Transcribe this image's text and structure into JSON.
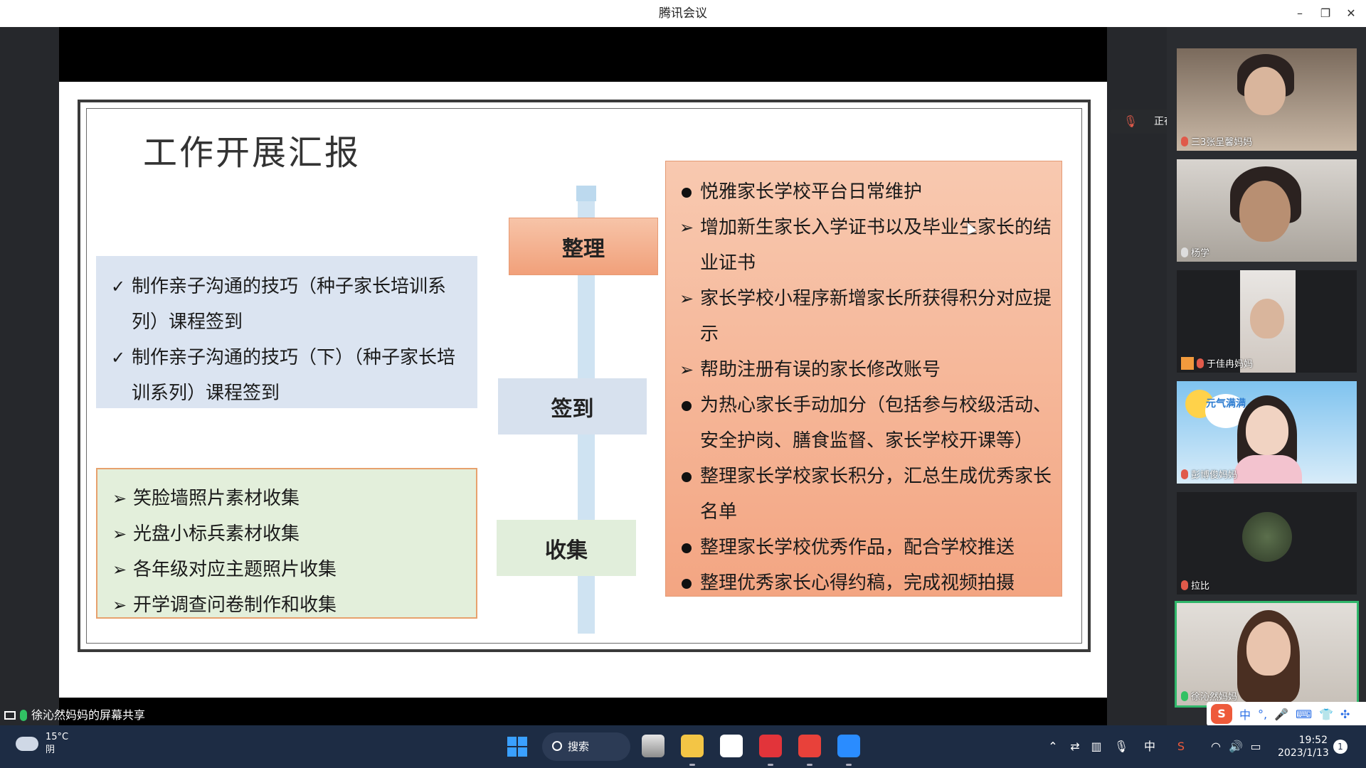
{
  "window": {
    "title": "腾讯会议",
    "minimize": "–",
    "restore": "❐",
    "close": "✕"
  },
  "slide": {
    "title": "工作开展汇报",
    "labels": {
      "zhengli": "整理",
      "qiandao": "签到",
      "shouji": "收集"
    },
    "qiandao_items": [
      "制作亲子沟通的技巧（种子家长培训系列）课程签到",
      "制作亲子沟通的技巧（下）（种子家长培训系列）课程签到"
    ],
    "shouji_items": [
      "笑脸墙照片素材收集",
      "光盘小标兵素材收集",
      "各年级对应主题照片收集",
      "开学调查问卷制作和收集"
    ],
    "zhengli_items": [
      {
        "type": "dot",
        "text": "悦雅家长学校平台日常维护"
      },
      {
        "type": "arrow",
        "text": "增加新生家长入学证书以及毕业生家长的结业证书"
      },
      {
        "type": "arrow",
        "text": "家长学校小程序新增家长所获得积分对应提示"
      },
      {
        "type": "arrow",
        "text": "帮助注册有误的家长修改账号"
      },
      {
        "type": "dot",
        "text": "为热心家长手动加分（包括参与校级活动、安全护岗、膳食监督、家长学校开课等）"
      },
      {
        "type": "dot",
        "text": "整理家长学校家长积分，汇总生成优秀家长名单"
      },
      {
        "type": "dot",
        "text": "整理家长学校优秀作品，配合学校推送"
      },
      {
        "type": "dot",
        "text": "整理优秀家长心得约稿，完成视频拍摄"
      }
    ]
  },
  "speaking": {
    "text": "正在讲话: 徐沁然妈妈;"
  },
  "participants": [
    {
      "name": "三3张呈馨妈妈",
      "muted": true
    },
    {
      "name": "杨学",
      "muted": false
    },
    {
      "name": "于佳冉妈妈",
      "muted": true
    },
    {
      "name": "彭博俊妈妈",
      "muted": true,
      "banner": "元气满满"
    },
    {
      "name": "拉比",
      "muted": true
    },
    {
      "name": "徐沁然妈妈",
      "muted": false,
      "active": true
    }
  ],
  "share_status": "徐沁然妈妈的屏幕共享",
  "taskbar": {
    "weather_temp": "15°C",
    "weather_desc": "阴",
    "search_label": "搜索",
    "ime_lang": "中",
    "time": "19:52",
    "date": "2023/1/13",
    "notifications": "1"
  },
  "ime": {
    "logo": "S",
    "lang": "中",
    "punct": "°,",
    "mic": "🎤",
    "keyboard": "⌨",
    "shirt": "👕",
    "apps": "✣"
  },
  "colors": {
    "accent_green": "#2fb66a",
    "taskbar": "#1d2c44"
  }
}
